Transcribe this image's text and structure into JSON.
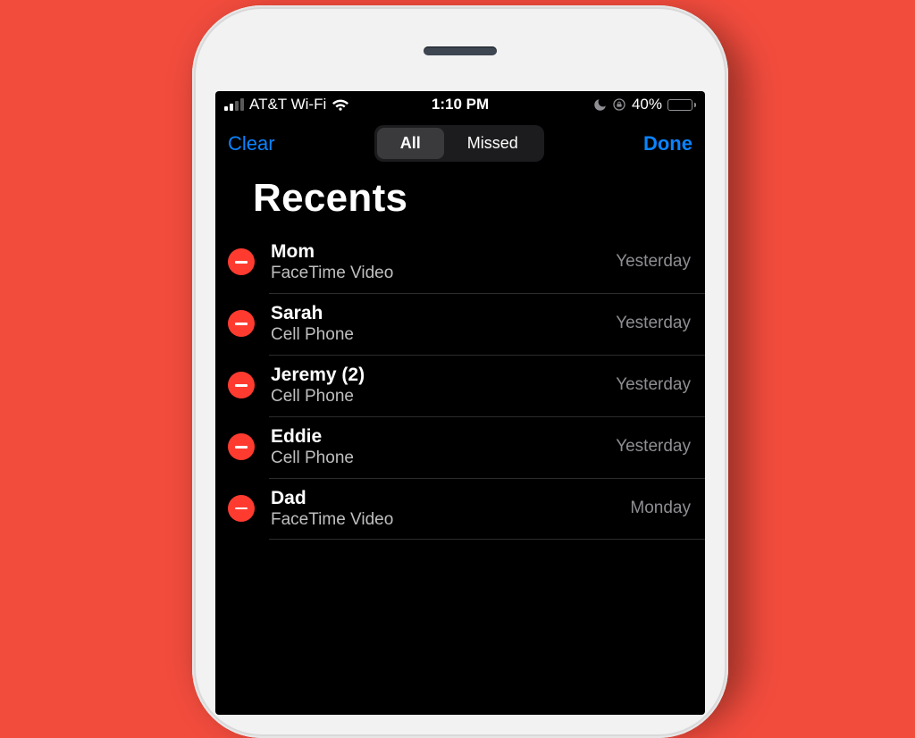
{
  "status": {
    "carrier": "AT&T Wi-Fi",
    "time": "1:10 PM",
    "battery_pct": "40%"
  },
  "nav": {
    "left": "Clear",
    "right": "Done",
    "segments": {
      "all": "All",
      "missed": "Missed"
    },
    "active_segment": "All"
  },
  "screen_title": "Recents",
  "calls": [
    {
      "name": "Mom",
      "sub": "FaceTime Video",
      "time": "Yesterday"
    },
    {
      "name": "Sarah",
      "sub": "Cell Phone",
      "time": "Yesterday"
    },
    {
      "name": "Jeremy (2)",
      "sub": "Cell Phone",
      "time": "Yesterday"
    },
    {
      "name": "Eddie",
      "sub": "Cell Phone",
      "time": "Yesterday"
    },
    {
      "name": "Dad",
      "sub": "FaceTime Video",
      "time": "Monday"
    }
  ]
}
